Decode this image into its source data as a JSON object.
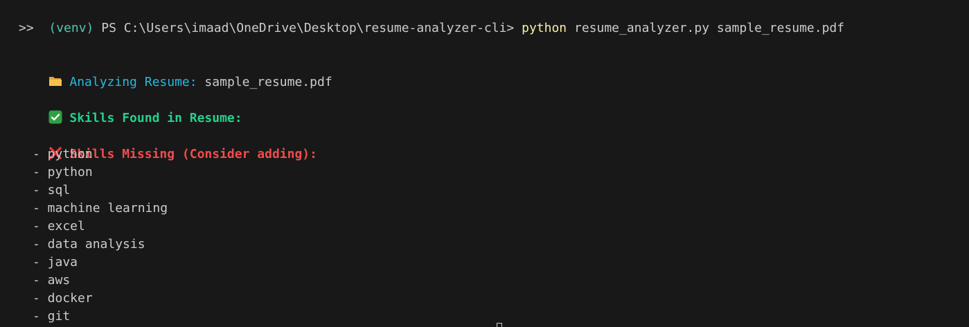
{
  "terminal": {
    "prompt": {
      "venv": "(venv)",
      "path": " PS C:\\Users\\imaad\\OneDrive\\Desktop\\resume-analyzer-cli> ",
      "command": "python",
      "args": " resume_analyzer.py sample_resume.pdf"
    },
    "continuation": ">>",
    "analyzing": {
      "icon": "folder-icon",
      "label": "Analyzing Resume:",
      "file": " sample_resume.pdf"
    },
    "found": {
      "icon": "check-icon",
      "label": "Skills Found in Resume:"
    },
    "missing": {
      "icon": "cross-icon",
      "label": "Skills Missing (Consider adding):",
      "items": [
        "- python",
        "- python",
        "- sql",
        "- machine learning",
        "- excel",
        "- data analysis",
        "- java",
        "- aws",
        "- docker",
        "- git"
      ]
    },
    "colors": {
      "background": "#181818",
      "text": "#cccccc",
      "command": "#f9f1a5",
      "cyan": "#29b8db",
      "green": "#23d18b",
      "red": "#f14c4c"
    }
  }
}
